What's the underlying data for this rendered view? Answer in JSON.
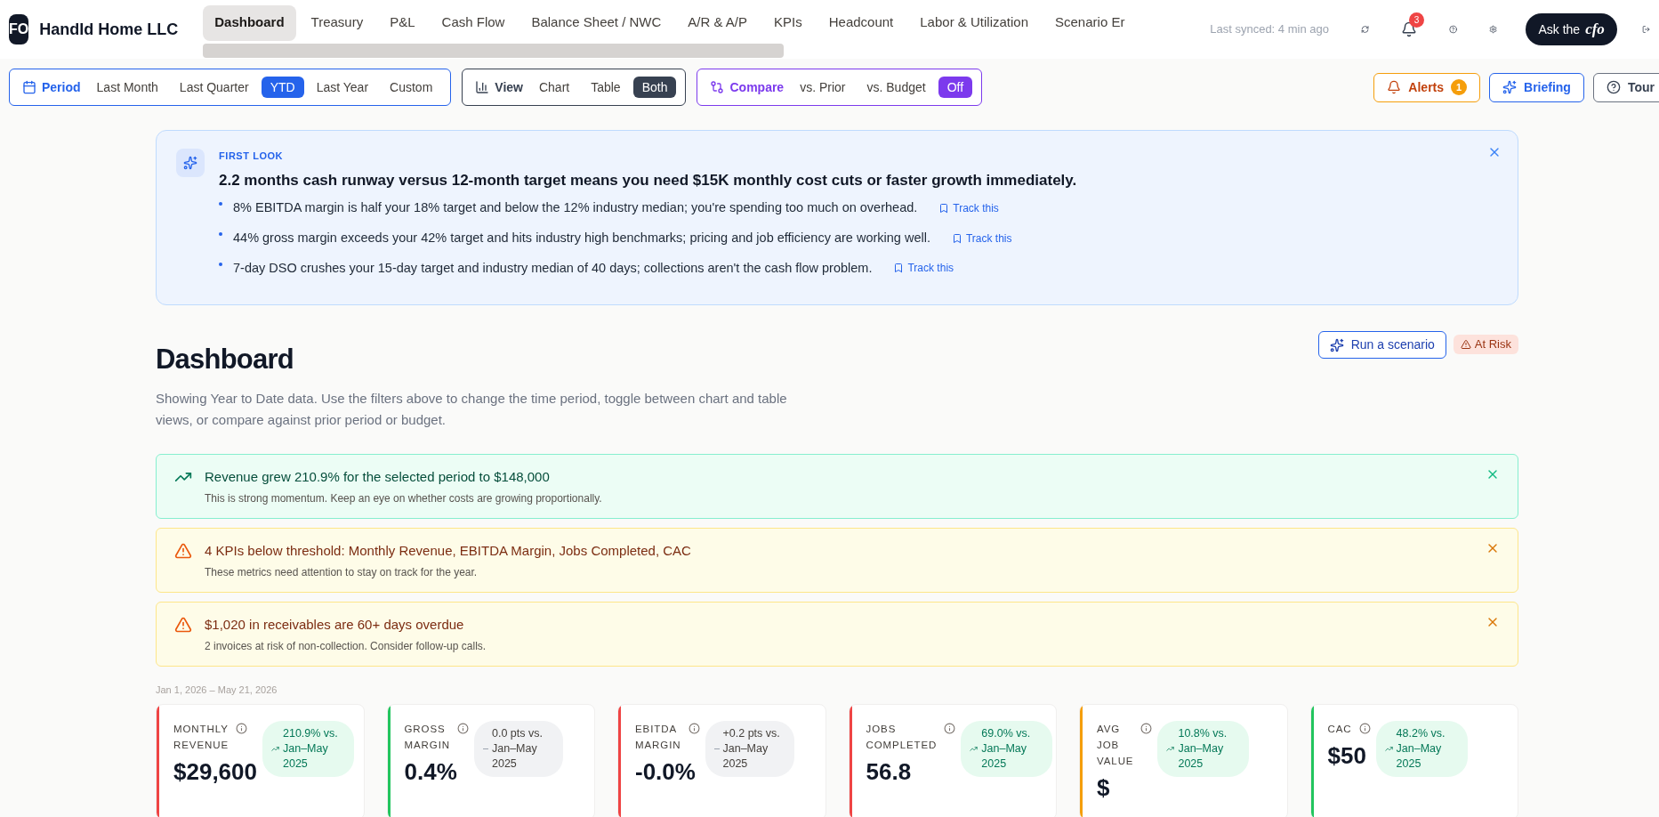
{
  "company": {
    "initials": "FO",
    "name": "Handld Home LLC"
  },
  "nav_tabs": [
    {
      "label": "Dashboard",
      "selected": true
    },
    {
      "label": "Treasury",
      "selected": false
    },
    {
      "label": "P&L",
      "selected": false
    },
    {
      "label": "Cash Flow",
      "selected": false
    },
    {
      "label": "Balance Sheet / NWC",
      "selected": false
    },
    {
      "label": "A/R & A/P",
      "selected": false
    },
    {
      "label": "KPIs",
      "selected": false
    },
    {
      "label": "Headcount",
      "selected": false
    },
    {
      "label": "Labor & Utilization",
      "selected": false
    },
    {
      "label": "Scenario Er",
      "selected": false
    }
  ],
  "last_synced": "Last synced: 4 min ago",
  "notifications_count": "3",
  "ask_button": {
    "label": "Ask the",
    "logo": "cfo"
  },
  "filters": [
    {
      "kind": "period",
      "label": "Period",
      "options": [
        {
          "label": "Last Month",
          "selected": false
        },
        {
          "label": "Last Quarter",
          "selected": false
        },
        {
          "label": "YTD",
          "selected": true
        },
        {
          "label": "Last Year",
          "selected": false
        },
        {
          "label": "Custom",
          "selected": false
        }
      ]
    },
    {
      "kind": "view",
      "label": "View",
      "options": [
        {
          "label": "Chart",
          "selected": false
        },
        {
          "label": "Table",
          "selected": false
        },
        {
          "label": "Both",
          "selected": true
        }
      ]
    },
    {
      "kind": "compare",
      "label": "Compare",
      "options": [
        {
          "label": "vs. Prior",
          "selected": false
        },
        {
          "label": "vs. Budget",
          "selected": false
        },
        {
          "label": "Off",
          "selected": true
        }
      ]
    }
  ],
  "toolbar_buttons": [
    {
      "kind": "alerts",
      "label": "Alerts",
      "count": "1"
    },
    {
      "kind": "briefing",
      "label": "Briefing"
    },
    {
      "kind": "tour",
      "label": "Tour"
    }
  ],
  "first_look": {
    "eyebrow": "FIRST LOOK",
    "headline": "2.2 months cash runway versus 12-month target means you need $15K monthly cost cuts or faster growth immediately.",
    "points": [
      {
        "text": "8% EBITDA margin is half your 18% target and below the 12% industry median; you're spending too much on overhead.",
        "action": "Track this"
      },
      {
        "text": "44% gross margin exceeds your 42% target and hits industry high benchmarks; pricing and job efficiency are working well.",
        "action": "Track this"
      },
      {
        "text": "7-day DSO crushes your 15-day target and industry median of 40 days; collections aren't the cash flow problem.",
        "action": "Track this"
      }
    ]
  },
  "page": {
    "title": "Dashboard",
    "description": "Showing Year to Date data. Use the filters above to change the time period, toggle between chart and table views, or compare against prior period or budget.",
    "scenario_button": "Run a scenario",
    "status_badge": "At Risk"
  },
  "alerts": [
    {
      "kind": "success",
      "title": "Revenue grew 210.9% for the selected period to $148,000",
      "detail": "This is strong momentum. Keep an eye on whether costs are growing proportionally."
    },
    {
      "kind": "warning",
      "title": "4 KPIs below threshold: Monthly Revenue, EBITDA Margin, Jobs Completed, CAC",
      "detail": "These metrics need attention to stay on track for the year."
    },
    {
      "kind": "warning",
      "title": "$1,020 in receivables are 60+ days overdue",
      "detail": "2 invoices at risk of non-collection. Consider follow-up calls."
    }
  ],
  "date_range": "Jan 1, 2026 – May 21, 2026",
  "kpis": [
    {
      "label": "MONTHLY REVENUE",
      "value": "$29,600",
      "delta": "210.9% vs. Jan–May 2025",
      "color": "#ef4444",
      "positive": true
    },
    {
      "label": "GROSS MARGIN",
      "value": "0.4%",
      "delta": "0.0 pts vs. Jan–May 2025",
      "color": "#22c55e",
      "positive": false
    },
    {
      "label": "EBITDA MARGIN",
      "value": "-0.0%",
      "delta": "+0.2 pts vs. Jan–May 2025",
      "color": "#ef4444",
      "positive": false
    },
    {
      "label": "JOBS COMPLETED",
      "value": "56.8",
      "delta": "69.0% vs. Jan–May 2025",
      "color": "#ef4444",
      "positive": true
    },
    {
      "label": "AVG JOB VALUE",
      "value": "$",
      "delta": "10.8% vs. Jan–May 2025",
      "color": "#f59e0b",
      "positive": true
    },
    {
      "label": "CAC",
      "value": "$50",
      "delta": "48.2% vs. Jan–May 2025",
      "color": "#22c55e",
      "positive": true
    }
  ]
}
